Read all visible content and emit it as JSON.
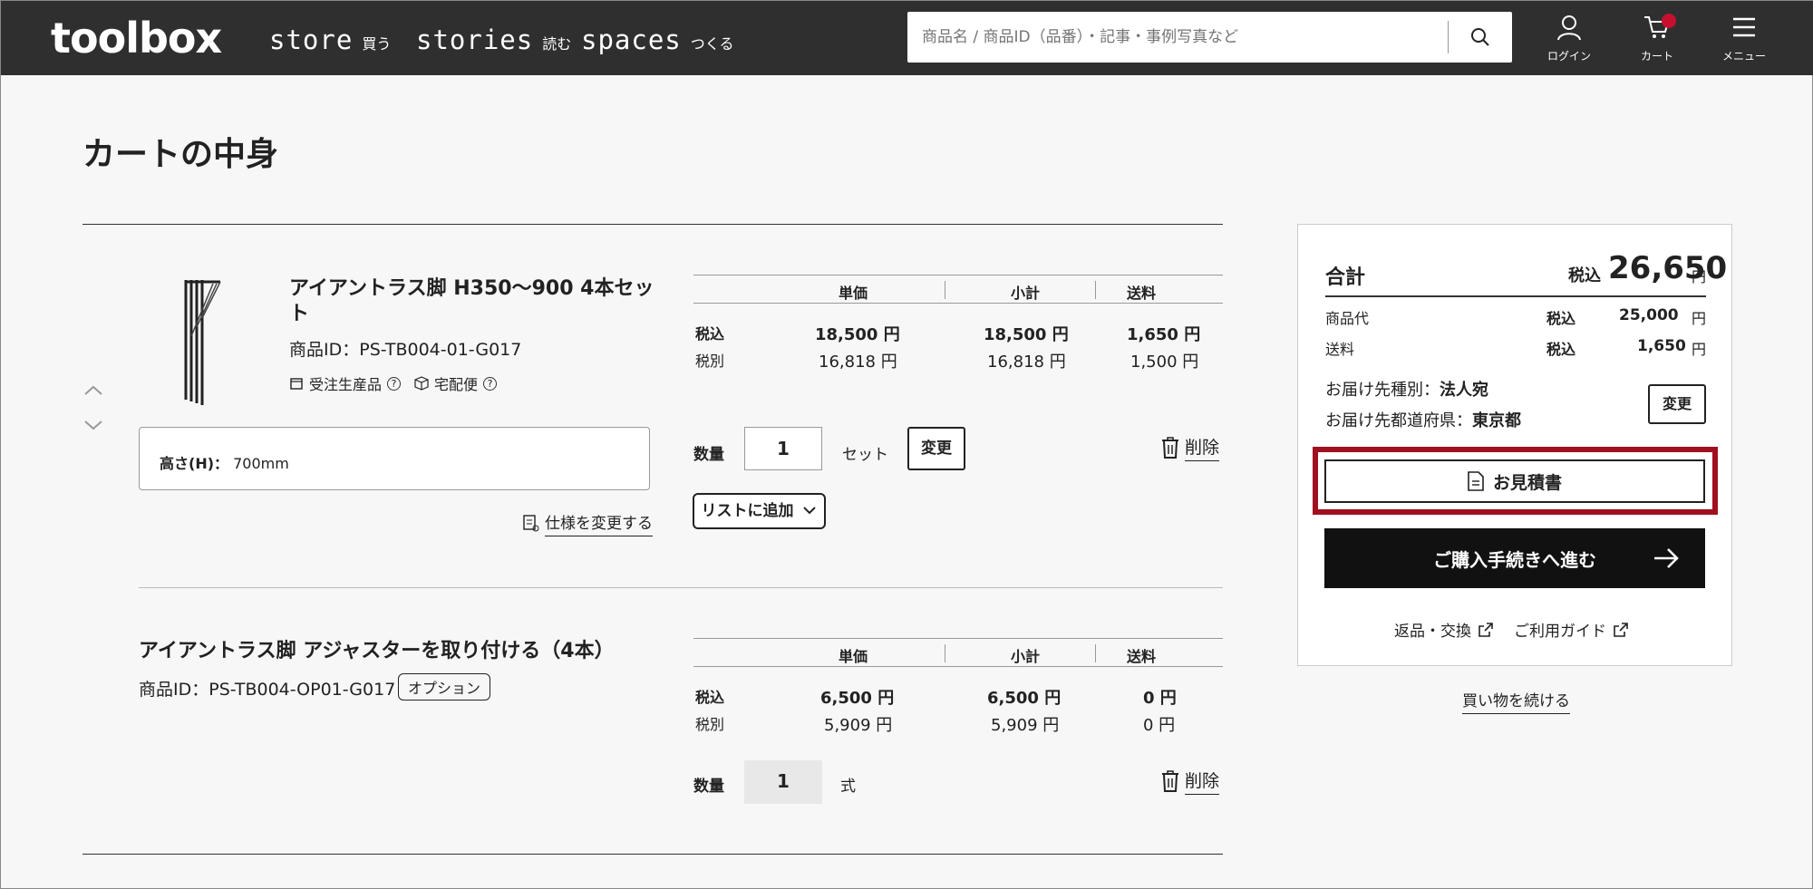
{
  "header": {
    "logo": "toolbox",
    "nav": [
      {
        "label": "store",
        "sub": "買う"
      },
      {
        "label": "stories",
        "sub": "読む"
      },
      {
        "label": "spaces",
        "sub": "つくる"
      }
    ],
    "search_placeholder": "商品名 / 商品ID（品番）・記事・事例写真など",
    "login_label": "ログイン",
    "cart_label": "カート",
    "menu_label": "メニュー"
  },
  "page": {
    "title": "カートの中身"
  },
  "cols": {
    "unit": "単価",
    "subtotal": "小計",
    "shipping": "送料"
  },
  "labels": {
    "tax_in": "税込",
    "tax_ex": "税別",
    "qty": "数量",
    "change": "変更",
    "delete": "削除",
    "add_list": "リストに追加",
    "change_spec": "仕様を変更する"
  },
  "items": [
    {
      "name_line1": "アイアントラス脚 H350〜900 4本セッ",
      "name_line2": "ト",
      "product_id": "商品ID：PS-TB004-01-G017",
      "tag1": "受注生産品",
      "tag2": "宅配便",
      "spec_label": "高さ(H)：",
      "spec_value": "700mm",
      "unit_in": "18,500 円",
      "sub_in": "18,500 円",
      "ship_in": "1,650 円",
      "unit_ex": "16,818 円",
      "sub_ex": "16,818 円",
      "ship_ex": "1,500 円",
      "qty": "1",
      "unit": "セット"
    },
    {
      "name": "アイアントラス脚 アジャスターを取り付ける（4本）",
      "product_id": "商品ID：PS-TB004-OP01-G017",
      "badge": "オプション",
      "unit_in": "6,500 円",
      "sub_in": "6,500 円",
      "ship_in": "0 円",
      "unit_ex": "5,909 円",
      "sub_ex": "5,909 円",
      "ship_ex": "0 円",
      "qty": "1",
      "unit": "式"
    }
  ],
  "summary": {
    "total_label": "合計",
    "tax_in": "税込",
    "total_value": "26,650",
    "yen": "円",
    "goods_label": "商品代",
    "goods_value": "25,000",
    "ship_label": "送料",
    "ship_value": "1,650",
    "dest_type_label": "お届け先種別：",
    "dest_type_value": "法人宛",
    "dest_pref_label": "お届け先都道府県：",
    "dest_pref_value": "東京都",
    "change": "変更",
    "quote": "お見積書",
    "checkout": "ご購入手続きへ進む",
    "returns": "返品・交換",
    "guide": "ご利用ガイド",
    "continue": "買い物を続ける"
  }
}
